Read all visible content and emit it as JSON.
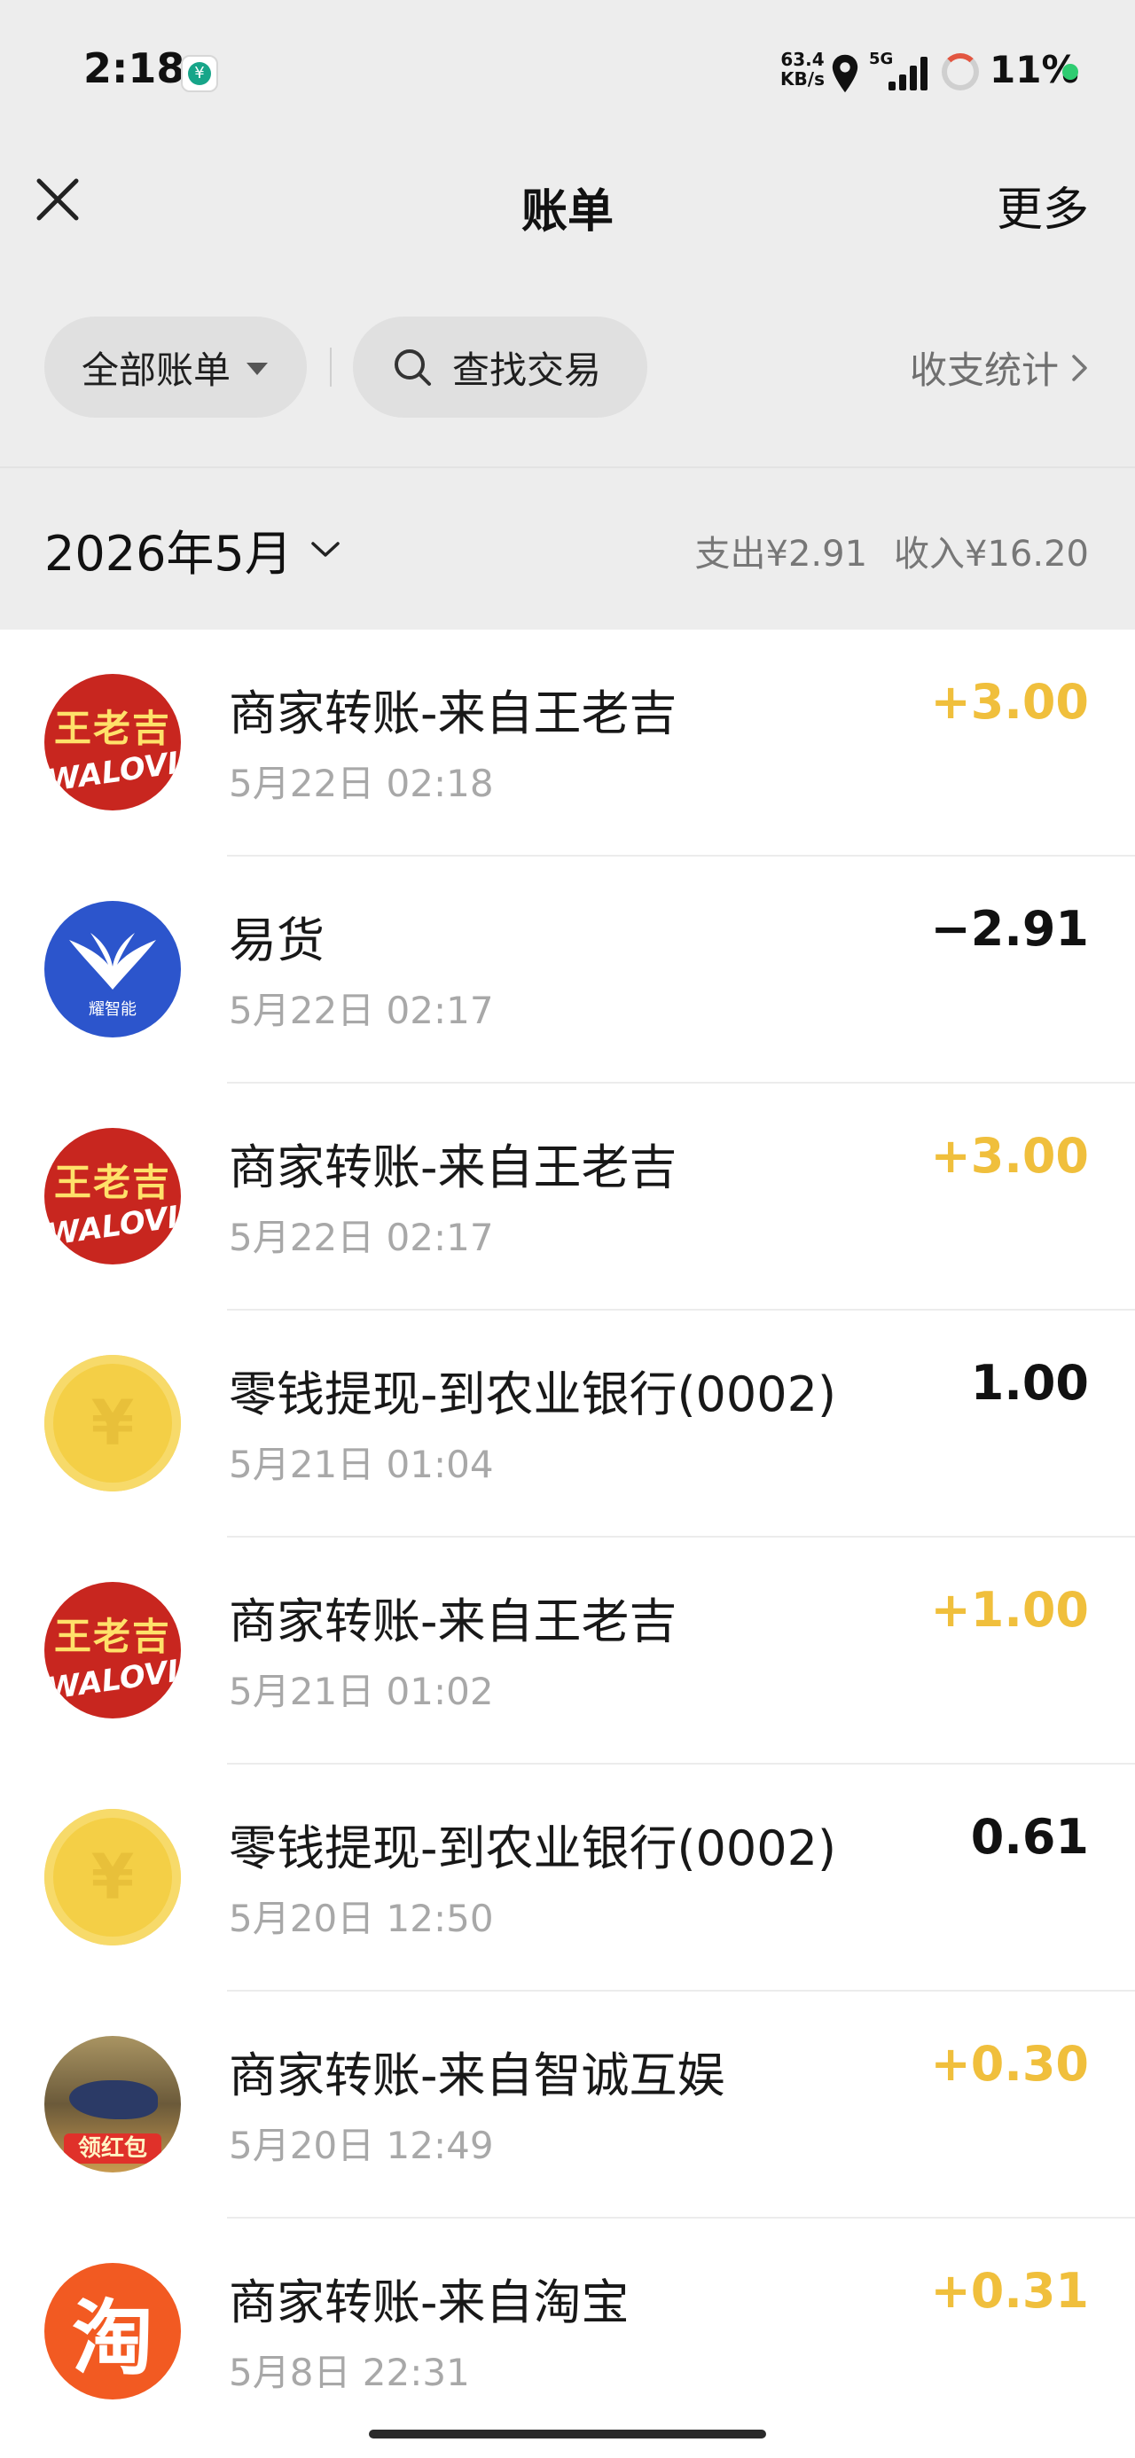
{
  "status_bar": {
    "time": "2:18",
    "net_speed_value": "63.4",
    "net_speed_unit": "KB/s",
    "signal_label": "5G",
    "battery": "11%",
    "app_icon_glyph": "¥"
  },
  "nav": {
    "title": "账单",
    "more": "更多"
  },
  "filters": {
    "all_bills": "全部账单",
    "search": "查找交易",
    "stats": "收支统计"
  },
  "month": {
    "label": "2026年5月",
    "expense": "支出¥2.91",
    "income": "收入¥16.20"
  },
  "transactions": [
    {
      "title": "商家转账-来自王老吉",
      "time": "5月22日 02:18",
      "amount": "+3.00",
      "type": "income",
      "avatar": "wanglaoji-logo",
      "avatar_text_1": "王老吉",
      "avatar_text_2": "WALOVI"
    },
    {
      "title": "易货",
      "time": "5月22日 02:17",
      "amount": "−2.91",
      "type": "expense",
      "avatar": "winged-logo",
      "avatar_text_1": "耀智能",
      "avatar_text_2": ""
    },
    {
      "title": "商家转账-来自王老吉",
      "time": "5月22日 02:17",
      "amount": "+3.00",
      "type": "income",
      "avatar": "wanglaoji-logo",
      "avatar_text_1": "王老吉",
      "avatar_text_2": "WALOVI"
    },
    {
      "title": "零钱提现-到农业银行(0002)",
      "time": "5月21日 01:04",
      "amount": "1.00",
      "type": "neutral",
      "avatar": "yuan-coin",
      "avatar_text_1": "¥",
      "avatar_text_2": ""
    },
    {
      "title": "商家转账-来自王老吉",
      "time": "5月21日 01:02",
      "amount": "+1.00",
      "type": "income",
      "avatar": "wanglaoji-logo",
      "avatar_text_1": "王老吉",
      "avatar_text_2": "WALOVI"
    },
    {
      "title": "零钱提现-到农业银行(0002)",
      "time": "5月20日 12:50",
      "amount": "0.61",
      "type": "neutral",
      "avatar": "yuan-coin",
      "avatar_text_1": "¥",
      "avatar_text_2": ""
    },
    {
      "title": "商家转账-来自智诚互娱",
      "time": "5月20日 12:49",
      "amount": "+0.30",
      "type": "income",
      "avatar": "whale-game-logo",
      "avatar_text_1": "领红包",
      "avatar_text_2": ""
    },
    {
      "title": "商家转账-来自淘宝",
      "time": "5月8日 22:31",
      "amount": "+0.31",
      "type": "income",
      "avatar": "taobao-logo",
      "avatar_text_1": "淘",
      "avatar_text_2": ""
    }
  ],
  "colors": {
    "income": "#f0bf3c",
    "expense": "#111111",
    "header_bg": "#ededed",
    "wanglaoji_red": "#c8261f",
    "taobao_orange": "#f25a22"
  }
}
